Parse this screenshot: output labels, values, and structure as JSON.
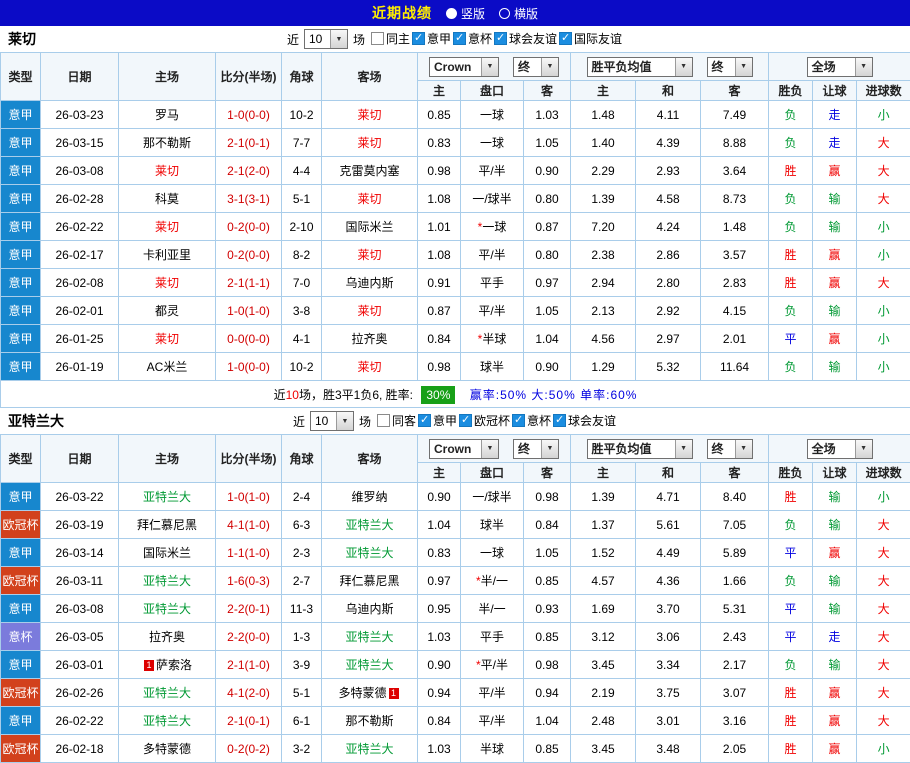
{
  "topbar": {
    "title": "近期战绩",
    "vertical_label": "竖版",
    "horizontal_label": "横版"
  },
  "colors": {
    "topbar_bg": "#0b0bc6",
    "title_text": "#ffee00",
    "serie_a": "#1787ce",
    "ucl": "#d2411c",
    "coppa": "#7b7bdc",
    "win_red": "#f00000",
    "lose_green": "#009933",
    "draw_blue": "#0000e0",
    "rate_badge_green": "#18a018",
    "grid_border": "#a9cdea"
  },
  "col_headers": {
    "type": "类型",
    "date": "日期",
    "home": "主场",
    "score": "比分(半场)",
    "corner": "角球",
    "away": "客场",
    "bookmaker": "Crown",
    "final": "终",
    "avg": "胜平负均值",
    "full": "全场",
    "odds_home": "主",
    "handicap": "盘口",
    "odds_away": "客",
    "avg_win": "主",
    "avg_draw": "和",
    "avg_lose": "客",
    "wdl": "胜负",
    "let_goal": "让球",
    "goals": "进球数"
  },
  "sections": [
    {
      "team": "莱切",
      "near_label": "近",
      "games_value": "10",
      "games_suffix": "场",
      "filters": [
        {
          "label": "同主",
          "checked": false
        },
        {
          "label": "意甲",
          "checked": true
        },
        {
          "label": "意杯",
          "checked": true
        },
        {
          "label": "球会友谊",
          "checked": true
        },
        {
          "label": "国际友谊",
          "checked": true
        }
      ],
      "rows": [
        {
          "type": "意甲",
          "league": "serie-a",
          "date": "26-03-23",
          "home": "罗马",
          "home_color": null,
          "score": "1-0(0-0)",
          "corner": "10-2",
          "away": "莱切",
          "away_color": "red",
          "odds_home": "0.85",
          "handicap": "一球",
          "odds_away": "1.03",
          "avg_win": "1.48",
          "avg_draw": "4.11",
          "avg_lose": "7.49",
          "result_wdl": "负",
          "result_handicap": "走",
          "result_goals": "小"
        },
        {
          "type": "意甲",
          "league": "serie-a",
          "date": "26-03-15",
          "home": "那不勒斯",
          "home_color": null,
          "score": "2-1(0-1)",
          "corner": "7-7",
          "away": "莱切",
          "away_color": "red",
          "odds_home": "0.83",
          "handicap": "一球",
          "odds_away": "1.05",
          "avg_win": "1.40",
          "avg_draw": "4.39",
          "avg_lose": "8.88",
          "result_wdl": "负",
          "result_handicap": "走",
          "result_goals": "大"
        },
        {
          "type": "意甲",
          "league": "serie-a",
          "date": "26-03-08",
          "home": "莱切",
          "home_color": "red",
          "score": "2-1(2-0)",
          "corner": "4-4",
          "away": "克雷莫内塞",
          "away_color": null,
          "odds_home": "0.98",
          "handicap": "平/半",
          "odds_away": "0.90",
          "avg_win": "2.29",
          "avg_draw": "2.93",
          "avg_lose": "3.64",
          "result_wdl": "胜",
          "result_handicap": "赢",
          "result_goals": "大"
        },
        {
          "type": "意甲",
          "league": "serie-a",
          "date": "26-02-28",
          "home": "科莫",
          "home_color": null,
          "score": "3-1(3-1)",
          "corner": "5-1",
          "away": "莱切",
          "away_color": "red",
          "odds_home": "1.08",
          "handicap": "一/球半",
          "odds_away": "0.80",
          "avg_win": "1.39",
          "avg_draw": "4.58",
          "avg_lose": "8.73",
          "result_wdl": "负",
          "result_handicap": "输",
          "result_goals": "大"
        },
        {
          "type": "意甲",
          "league": "serie-a",
          "date": "26-02-22",
          "home": "莱切",
          "home_color": "red",
          "score": "0-2(0-0)",
          "corner": "2-10",
          "away": "国际米兰",
          "away_color": null,
          "odds_home": "1.01",
          "handicap": "*一球",
          "odds_away": "0.87",
          "avg_win": "7.20",
          "avg_draw": "4.24",
          "avg_lose": "1.48",
          "result_wdl": "负",
          "result_handicap": "输",
          "result_goals": "小"
        },
        {
          "type": "意甲",
          "league": "serie-a",
          "date": "26-02-17",
          "home": "卡利亚里",
          "home_color": null,
          "score": "0-2(0-0)",
          "corner": "8-2",
          "away": "莱切",
          "away_color": "red",
          "odds_home": "1.08",
          "handicap": "平/半",
          "odds_away": "0.80",
          "avg_win": "2.38",
          "avg_draw": "2.86",
          "avg_lose": "3.57",
          "result_wdl": "胜",
          "result_handicap": "赢",
          "result_goals": "小"
        },
        {
          "type": "意甲",
          "league": "serie-a",
          "date": "26-02-08",
          "home": "莱切",
          "home_color": "red",
          "score": "2-1(1-1)",
          "corner": "7-0",
          "away": "乌迪内斯",
          "away_color": null,
          "odds_home": "0.91",
          "handicap": "平手",
          "odds_away": "0.97",
          "avg_win": "2.94",
          "avg_draw": "2.80",
          "avg_lose": "2.83",
          "result_wdl": "胜",
          "result_handicap": "赢",
          "result_goals": "大"
        },
        {
          "type": "意甲",
          "league": "serie-a",
          "date": "26-02-01",
          "home": "都灵",
          "home_color": null,
          "score": "1-0(1-0)",
          "corner": "3-8",
          "away": "莱切",
          "away_color": "red",
          "odds_home": "0.87",
          "handicap": "平/半",
          "odds_away": "1.05",
          "avg_win": "2.13",
          "avg_draw": "2.92",
          "avg_lose": "4.15",
          "result_wdl": "负",
          "result_handicap": "输",
          "result_goals": "小"
        },
        {
          "type": "意甲",
          "league": "serie-a",
          "date": "26-01-25",
          "home": "莱切",
          "home_color": "red",
          "score": "0-0(0-0)",
          "corner": "4-1",
          "away": "拉齐奥",
          "away_color": null,
          "odds_home": "0.84",
          "handicap": "*半球",
          "odds_away": "1.04",
          "avg_win": "4.56",
          "avg_draw": "2.97",
          "avg_lose": "2.01",
          "result_wdl": "平",
          "result_handicap": "赢",
          "result_goals": "小"
        },
        {
          "type": "意甲",
          "league": "serie-a",
          "date": "26-01-19",
          "home": "AC米兰",
          "home_color": null,
          "score": "1-0(0-0)",
          "corner": "10-2",
          "away": "莱切",
          "away_color": "red",
          "odds_home": "0.98",
          "handicap": "球半",
          "odds_away": "0.90",
          "avg_win": "1.29",
          "avg_draw": "5.32",
          "avg_lose": "11.64",
          "result_wdl": "负",
          "result_handicap": "输",
          "result_goals": "小"
        }
      ],
      "summary": {
        "near": "近",
        "count": "10",
        "text": "场，胜3平1负6, 胜率:",
        "win_rate": "30%",
        "stats": [
          "赢率:50%",
          "大:50%",
          "单率:60%"
        ]
      }
    },
    {
      "team": "亚特兰大",
      "near_label": "近",
      "games_value": "10",
      "games_suffix": "场",
      "filters": [
        {
          "label": "同客",
          "checked": false
        },
        {
          "label": "意甲",
          "checked": true
        },
        {
          "label": "欧冠杯",
          "checked": true
        },
        {
          "label": "意杯",
          "checked": true
        },
        {
          "label": "球会友谊",
          "checked": true
        }
      ],
      "rows": [
        {
          "type": "意甲",
          "league": "serie-a",
          "date": "26-03-22",
          "home": "亚特兰大",
          "home_color": "green",
          "score": "1-0(1-0)",
          "corner": "2-4",
          "away": "维罗纳",
          "away_color": null,
          "odds_home": "0.90",
          "handicap": "一/球半",
          "odds_away": "0.98",
          "avg_win": "1.39",
          "avg_draw": "4.71",
          "avg_lose": "8.40",
          "result_wdl": "胜",
          "result_handicap": "输",
          "result_goals": "小"
        },
        {
          "type": "欧冠杯",
          "league": "ucl",
          "date": "26-03-19",
          "home": "拜仁慕尼黑",
          "home_color": null,
          "score": "4-1(1-0)",
          "corner": "6-3",
          "away": "亚特兰大",
          "away_color": "green",
          "odds_home": "1.04",
          "handicap": "球半",
          "odds_away": "0.84",
          "avg_win": "1.37",
          "avg_draw": "5.61",
          "avg_lose": "7.05",
          "result_wdl": "负",
          "result_handicap": "输",
          "result_goals": "大"
        },
        {
          "type": "意甲",
          "league": "serie-a",
          "date": "26-03-14",
          "home": "国际米兰",
          "home_color": null,
          "score": "1-1(1-0)",
          "corner": "2-3",
          "away": "亚特兰大",
          "away_color": "green",
          "odds_home": "0.83",
          "handicap": "一球",
          "odds_away": "1.05",
          "avg_win": "1.52",
          "avg_draw": "4.49",
          "avg_lose": "5.89",
          "result_wdl": "平",
          "result_handicap": "赢",
          "result_goals": "大"
        },
        {
          "type": "欧冠杯",
          "league": "ucl",
          "date": "26-03-11",
          "home": "亚特兰大",
          "home_color": "green",
          "score": "1-6(0-3)",
          "corner": "2-7",
          "away": "拜仁慕尼黑",
          "away_color": null,
          "odds_home": "0.97",
          "handicap": "*半/一",
          "odds_away": "0.85",
          "avg_win": "4.57",
          "avg_draw": "4.36",
          "avg_lose": "1.66",
          "result_wdl": "负",
          "result_handicap": "输",
          "result_goals": "大"
        },
        {
          "type": "意甲",
          "league": "serie-a",
          "date": "26-03-08",
          "home": "亚特兰大",
          "home_color": "green",
          "score": "2-2(0-1)",
          "corner": "11-3",
          "away": "乌迪内斯",
          "away_color": null,
          "odds_home": "0.95",
          "handicap": "半/一",
          "odds_away": "0.93",
          "avg_win": "1.69",
          "avg_draw": "3.70",
          "avg_lose": "5.31",
          "result_wdl": "平",
          "result_handicap": "输",
          "result_goals": "大"
        },
        {
          "type": "意杯",
          "league": "coppa",
          "date": "26-03-05",
          "home": "拉齐奥",
          "home_color": null,
          "score": "2-2(0-0)",
          "corner": "1-3",
          "away": "亚特兰大",
          "away_color": "green",
          "odds_home": "1.03",
          "handicap": "平手",
          "odds_away": "0.85",
          "avg_win": "3.12",
          "avg_draw": "3.06",
          "avg_lose": "2.43",
          "result_wdl": "平",
          "result_handicap": "走",
          "result_goals": "大"
        },
        {
          "type": "意甲",
          "league": "serie-a",
          "date": "26-03-01",
          "home": "萨索洛",
          "home_color": null,
          "home_badge": "1",
          "home_badge_pos": "before",
          "score": "2-1(1-0)",
          "corner": "3-9",
          "away": "亚特兰大",
          "away_color": "green",
          "odds_home": "0.90",
          "handicap": "*平/半",
          "odds_away": "0.98",
          "avg_win": "3.45",
          "avg_draw": "3.34",
          "avg_lose": "2.17",
          "result_wdl": "负",
          "result_handicap": "输",
          "result_goals": "大"
        },
        {
          "type": "欧冠杯",
          "league": "ucl",
          "date": "26-02-26",
          "home": "亚特兰大",
          "home_color": "green",
          "score": "4-1(2-0)",
          "corner": "5-1",
          "away": "多特蒙德",
          "away_color": null,
          "away_badge": "1",
          "away_badge_pos": "after",
          "odds_home": "0.94",
          "handicap": "平/半",
          "odds_away": "0.94",
          "avg_win": "2.19",
          "avg_draw": "3.75",
          "avg_lose": "3.07",
          "result_wdl": "胜",
          "result_handicap": "赢",
          "result_goals": "大"
        },
        {
          "type": "意甲",
          "league": "serie-a",
          "date": "26-02-22",
          "home": "亚特兰大",
          "home_color": "green",
          "score": "2-1(0-1)",
          "corner": "6-1",
          "away": "那不勒斯",
          "away_color": null,
          "odds_home": "0.84",
          "handicap": "平/半",
          "odds_away": "1.04",
          "avg_win": "2.48",
          "avg_draw": "3.01",
          "avg_lose": "3.16",
          "result_wdl": "胜",
          "result_handicap": "赢",
          "result_goals": "大"
        },
        {
          "type": "欧冠杯",
          "league": "ucl",
          "date": "26-02-18",
          "home": "多特蒙德",
          "home_color": null,
          "score": "0-2(0-2)",
          "corner": "3-2",
          "away": "亚特兰大",
          "away_color": "green",
          "odds_home": "1.03",
          "handicap": "半球",
          "odds_away": "0.85",
          "avg_win": "3.45",
          "avg_draw": "3.48",
          "avg_lose": "2.05",
          "result_wdl": "胜",
          "result_handicap": "赢",
          "result_goals": "小"
        }
      ],
      "summary": null
    }
  ]
}
